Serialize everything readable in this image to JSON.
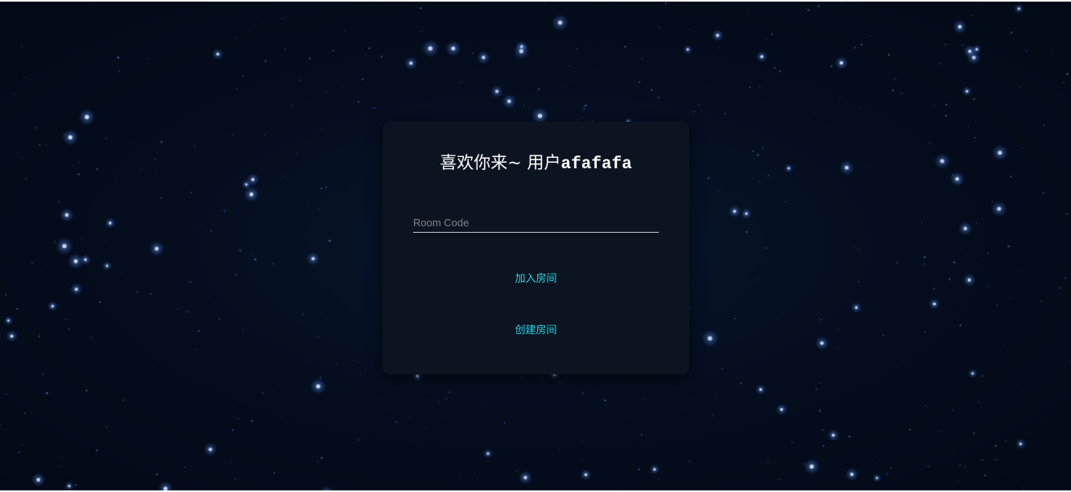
{
  "welcome": {
    "greeting": "喜欢你来~ 用户",
    "username": "afafafa"
  },
  "room_form": {
    "room_code_value": "",
    "room_code_placeholder": "Room Code",
    "join_label": "加入房间",
    "create_label": "创建房间"
  },
  "colors": {
    "background": "#040c1a",
    "card": "#0b1420",
    "accent": "#22d4e6",
    "star": "#4d8dff"
  }
}
